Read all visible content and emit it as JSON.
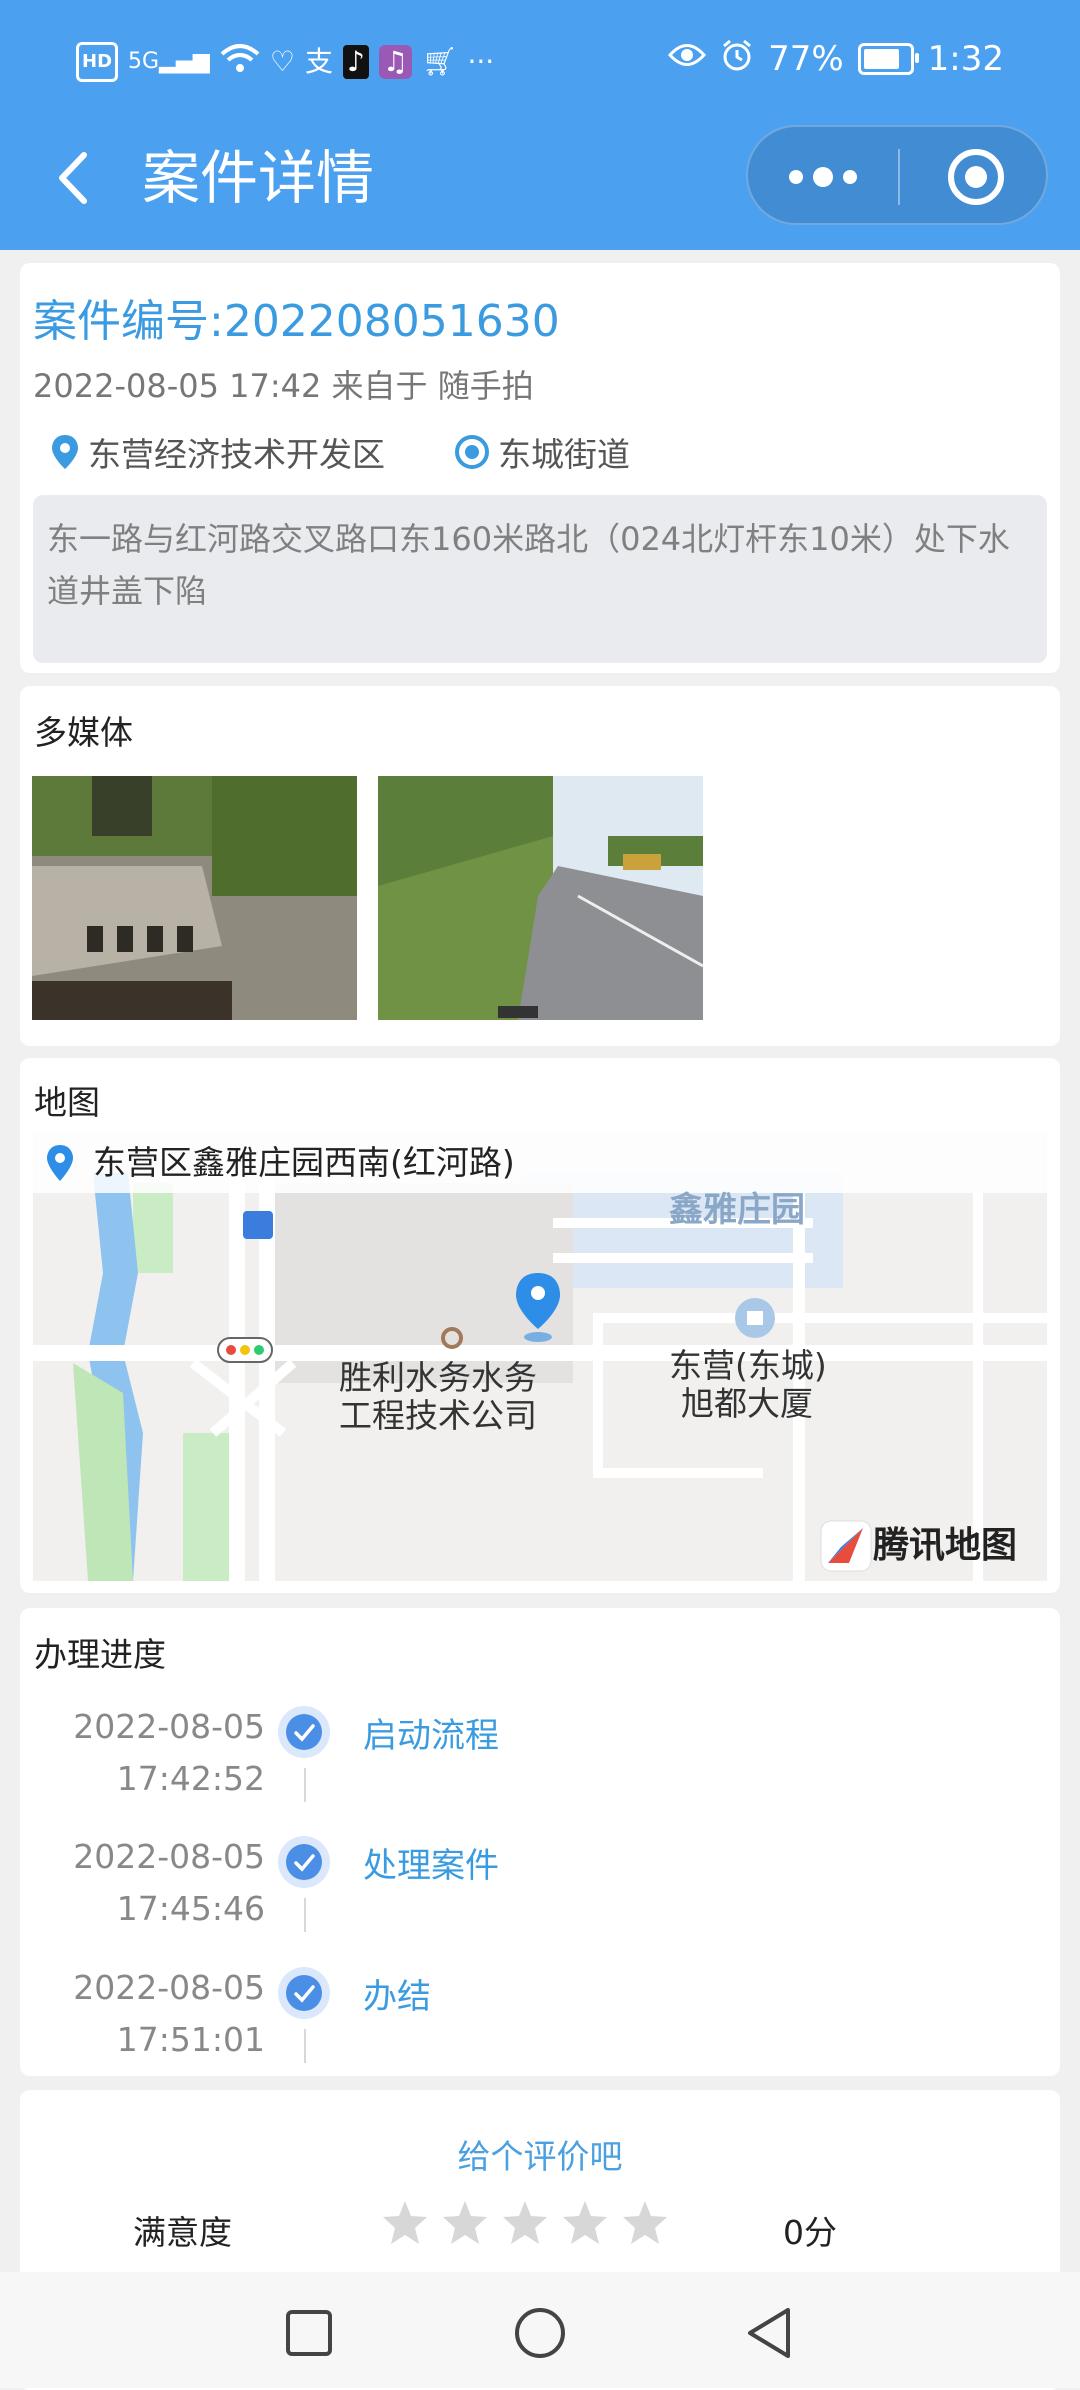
{
  "status_bar": {
    "battery": "77%",
    "time": "1:32",
    "hd_label": "HD",
    "signal_label": "5G"
  },
  "nav": {
    "title": "案件详情"
  },
  "case": {
    "number": "案件编号:202208051630",
    "meta": "2022-08-05 17:42 来自于 随手拍",
    "district": "东营经济技术开发区",
    "street": "东城街道",
    "description": "东一路与红河路交叉路口东160米路北（024北灯杆东10米）处下水道井盖下陷"
  },
  "media": {
    "title": "多媒体"
  },
  "map": {
    "title": "地图",
    "address": "东营区鑫雅庄园西南(红河路)",
    "labels": {
      "poi1_line1": "胜利水务水务",
      "poi1_line2": "工程技术公司",
      "poi2_line1": "东营(东城)",
      "poi2_line2": "旭都大厦",
      "area": "鑫雅庄园",
      "brand": "腾讯地图"
    }
  },
  "progress": {
    "title": "办理进度",
    "steps": [
      {
        "date": "2022-08-05",
        "time": "17:42:52",
        "label": "启动流程"
      },
      {
        "date": "2022-08-05",
        "time": "17:45:46",
        "label": "处理案件"
      },
      {
        "date": "2022-08-05",
        "time": "17:51:01",
        "label": "办结"
      }
    ]
  },
  "rating": {
    "title": "给个评价吧",
    "label": "满意度",
    "score": "0分",
    "stars_total": 5,
    "stars_filled": 0
  },
  "colors": {
    "header": "#4ba0f0",
    "accent": "#3b9be0"
  }
}
